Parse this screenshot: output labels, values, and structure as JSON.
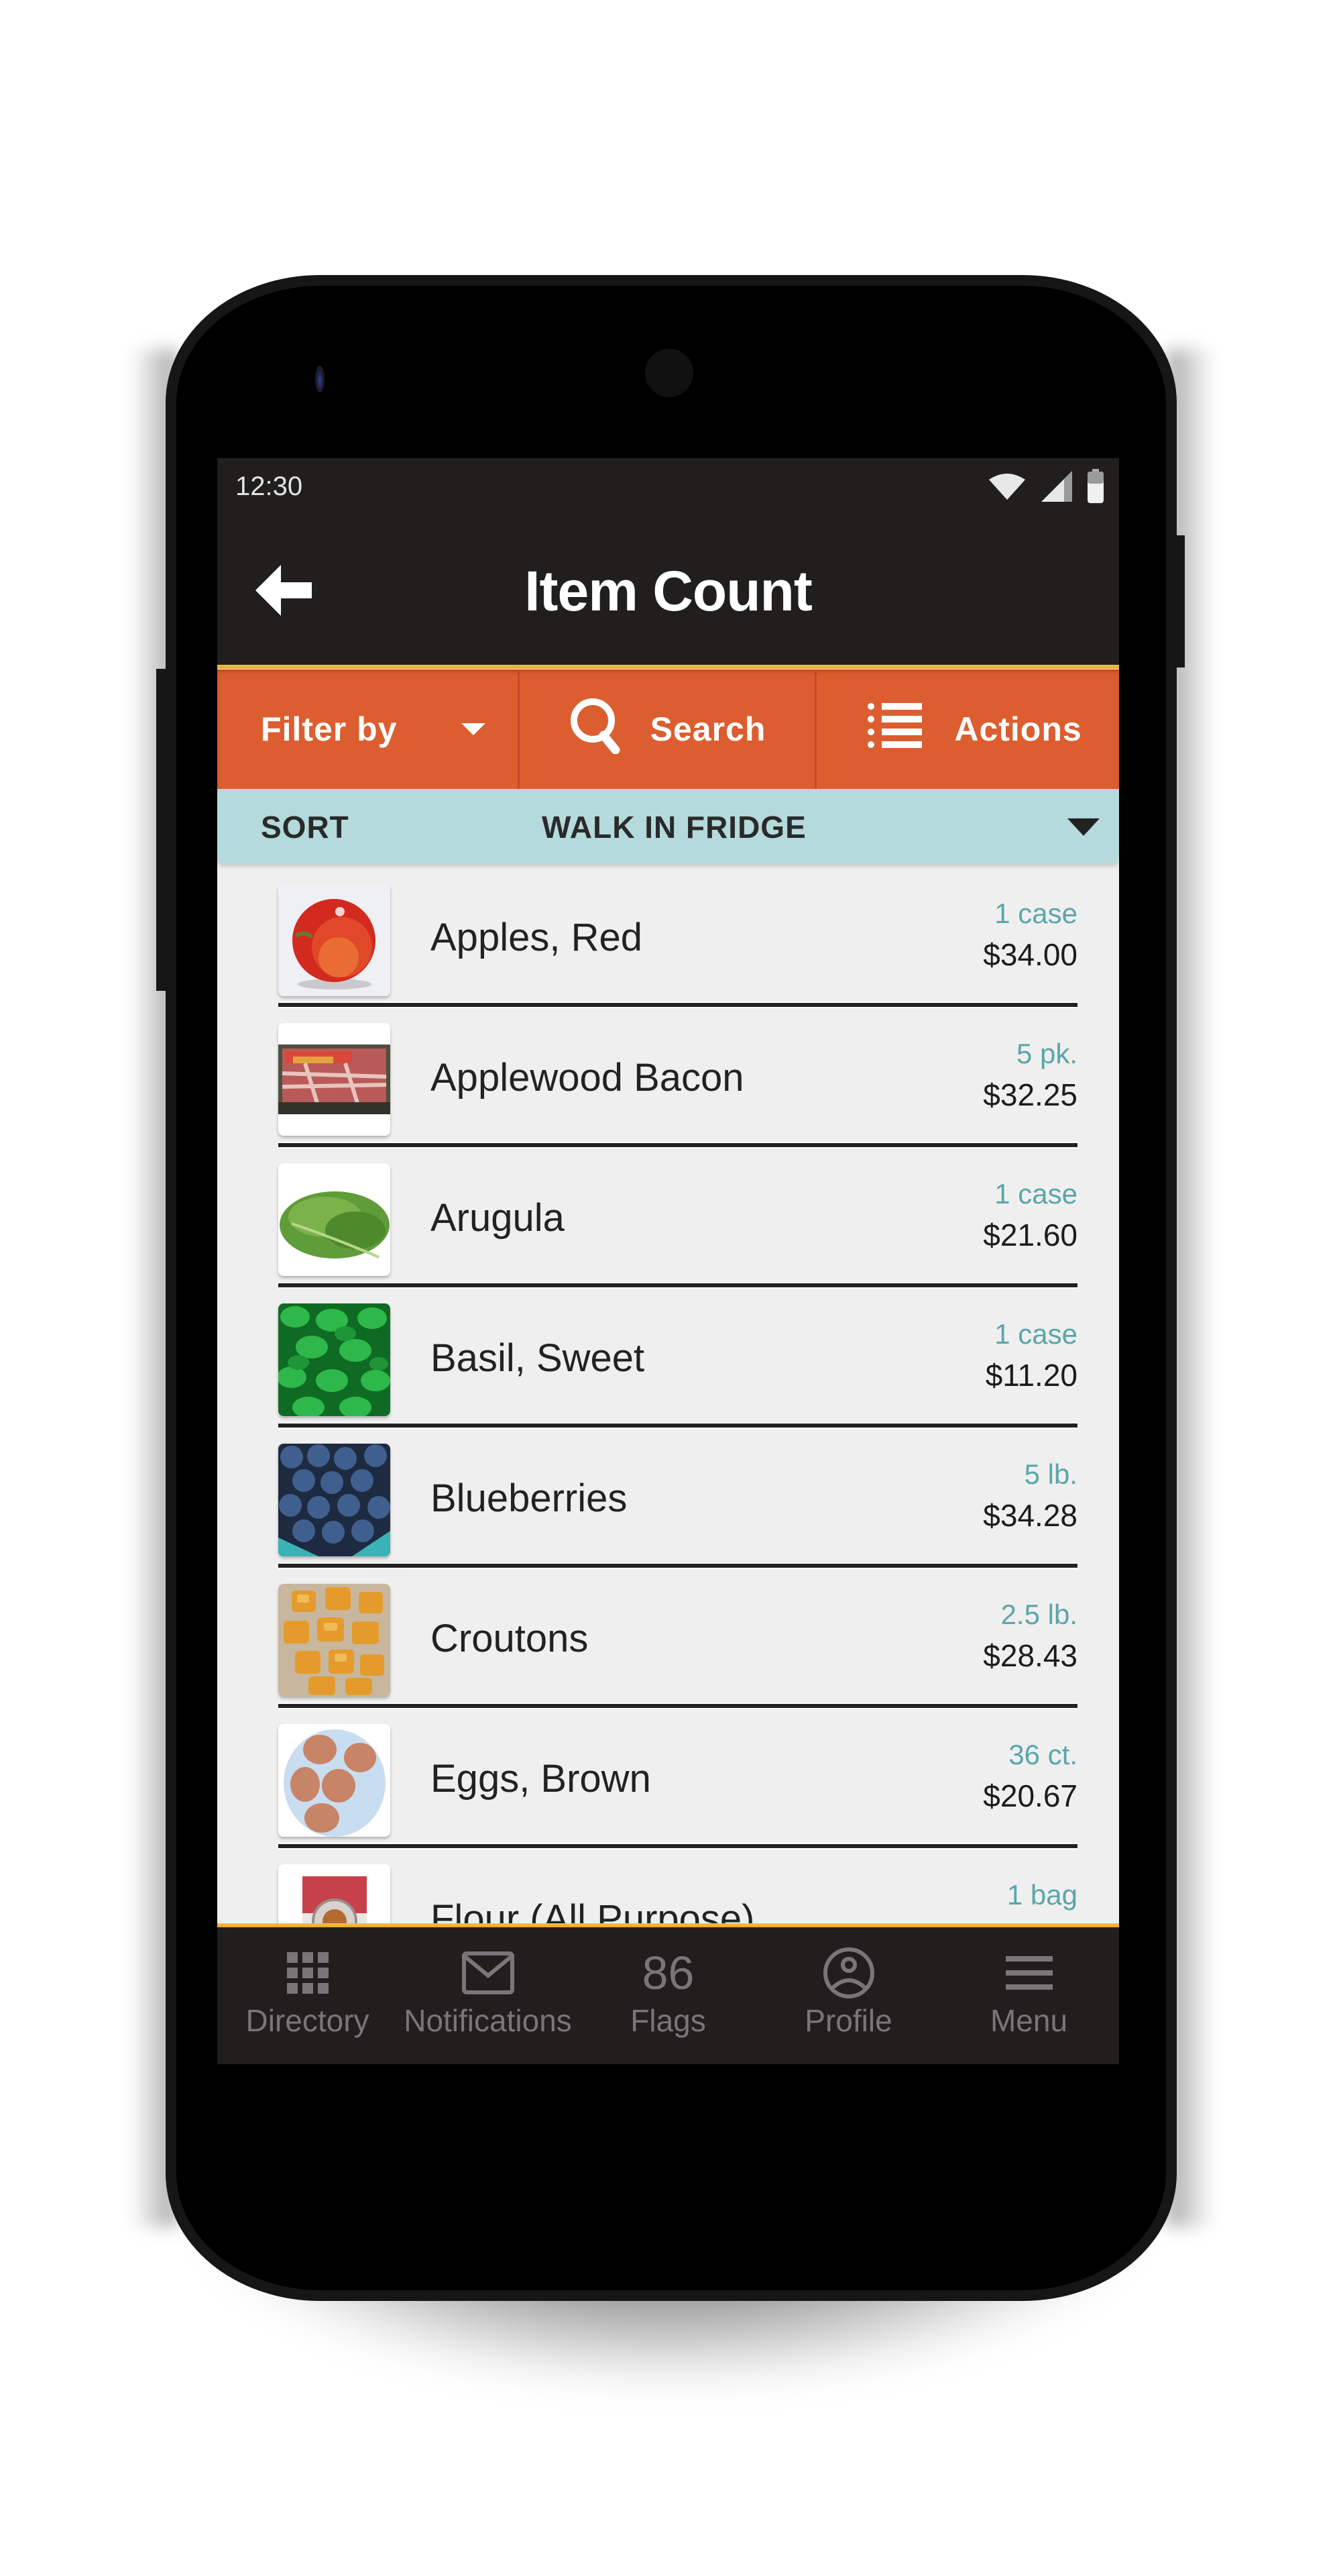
{
  "status_bar": {
    "time": "12:30",
    "icons": [
      "wifi-icon",
      "signal-icon",
      "battery-icon"
    ]
  },
  "app_bar": {
    "back_icon": "arrow-left-icon",
    "title": "Item Count"
  },
  "toolbar": {
    "filter_label": "Filter by",
    "filter_icon": "caret-down-icon",
    "search_label": "Search",
    "search_icon": "search-icon",
    "actions_label": "Actions",
    "actions_icon": "list-icon"
  },
  "sort_bar": {
    "label": "SORT",
    "value": "WALK IN FRIDGE",
    "icon": "caret-down-icon"
  },
  "items": [
    {
      "name": "Apples, Red",
      "qty": "1 case",
      "price": "$34.00",
      "thumb": "apple"
    },
    {
      "name": "Applewood Bacon",
      "qty": "5 pk.",
      "price": "$32.25",
      "thumb": "bacon"
    },
    {
      "name": "Arugula",
      "qty": "1 case",
      "price": "$21.60",
      "thumb": "arugula"
    },
    {
      "name": "Basil, Sweet",
      "qty": "1 case",
      "price": "$11.20",
      "thumb": "basil"
    },
    {
      "name": "Blueberries",
      "qty": "5 lb.",
      "price": "$34.28",
      "thumb": "blueberries"
    },
    {
      "name": "Croutons",
      "qty": "2.5 lb.",
      "price": "$28.43",
      "thumb": "croutons"
    },
    {
      "name": "Eggs, Brown",
      "qty": "36 ct.",
      "price": "$20.67",
      "thumb": "eggs"
    },
    {
      "name": "Flour (All Purpose)",
      "qty": "1 bag",
      "price": "",
      "thumb": "flour"
    }
  ],
  "bottom_nav": [
    {
      "label": "Directory",
      "icon": "grid-icon"
    },
    {
      "label": "Notifications",
      "icon": "envelope-icon"
    },
    {
      "label": "Flags",
      "count": "86"
    },
    {
      "label": "Profile",
      "icon": "user-circle-icon"
    },
    {
      "label": "Menu",
      "icon": "hamburger-icon"
    }
  ],
  "colors": {
    "app_bar": "#201f1e",
    "toolbar_orange": "#dc5e30",
    "sort_bar": "#b5dadb",
    "accent_yellow": "#f6c043",
    "qty_teal": "#5aa6aa",
    "list_bg": "#efefef",
    "nav_grey": "#7a7579"
  }
}
